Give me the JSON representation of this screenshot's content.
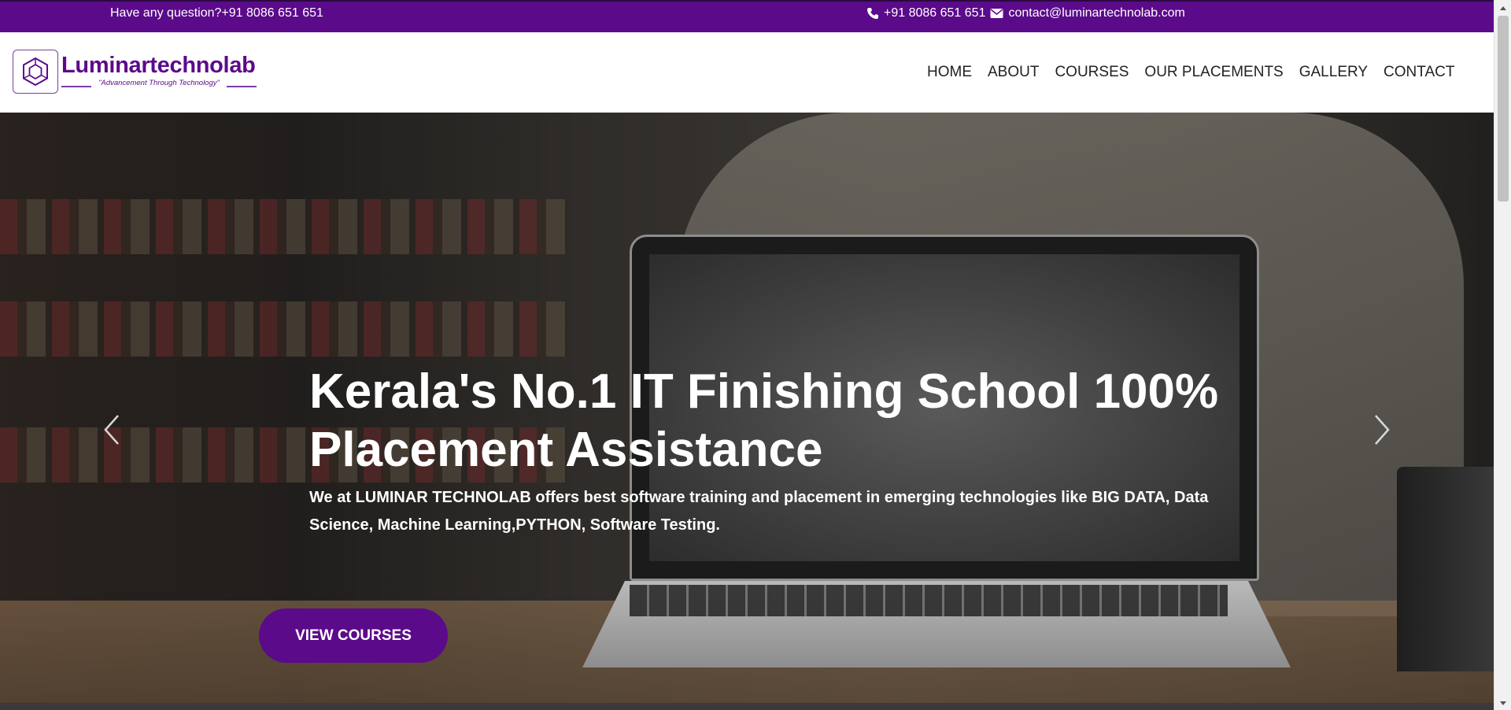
{
  "topbar": {
    "question": "Have any question?+91 8086 651 651",
    "phone": "+91 8086 651 651",
    "email": "contact@luminartechnolab.com",
    "phone_icon": "phone-icon",
    "email_icon": "envelope-icon"
  },
  "logo": {
    "name": "Luminartechnolab",
    "tagline": "\"Advancement Through Technology\""
  },
  "nav": {
    "items": [
      {
        "label": "HOME"
      },
      {
        "label": "ABOUT"
      },
      {
        "label": "COURSES"
      },
      {
        "label": "OUR PLACEMENTS"
      },
      {
        "label": "GALLERY"
      },
      {
        "label": "CONTACT"
      }
    ]
  },
  "hero": {
    "title": "Kerala's No.1 IT Finishing School 100% Placement Assistance",
    "text": "We at LUMINAR TECHNOLAB offers best software training and placement in emerging technologies like BIG DATA, Data Science, Machine Learning,PYTHON, Software Testing.",
    "button": "VIEW COURSES",
    "prev_icon": "chevron-left-icon",
    "next_icon": "chevron-right-icon"
  },
  "colors": {
    "brand": "#5b0a8a",
    "nav_text": "#222222",
    "white": "#ffffff"
  }
}
